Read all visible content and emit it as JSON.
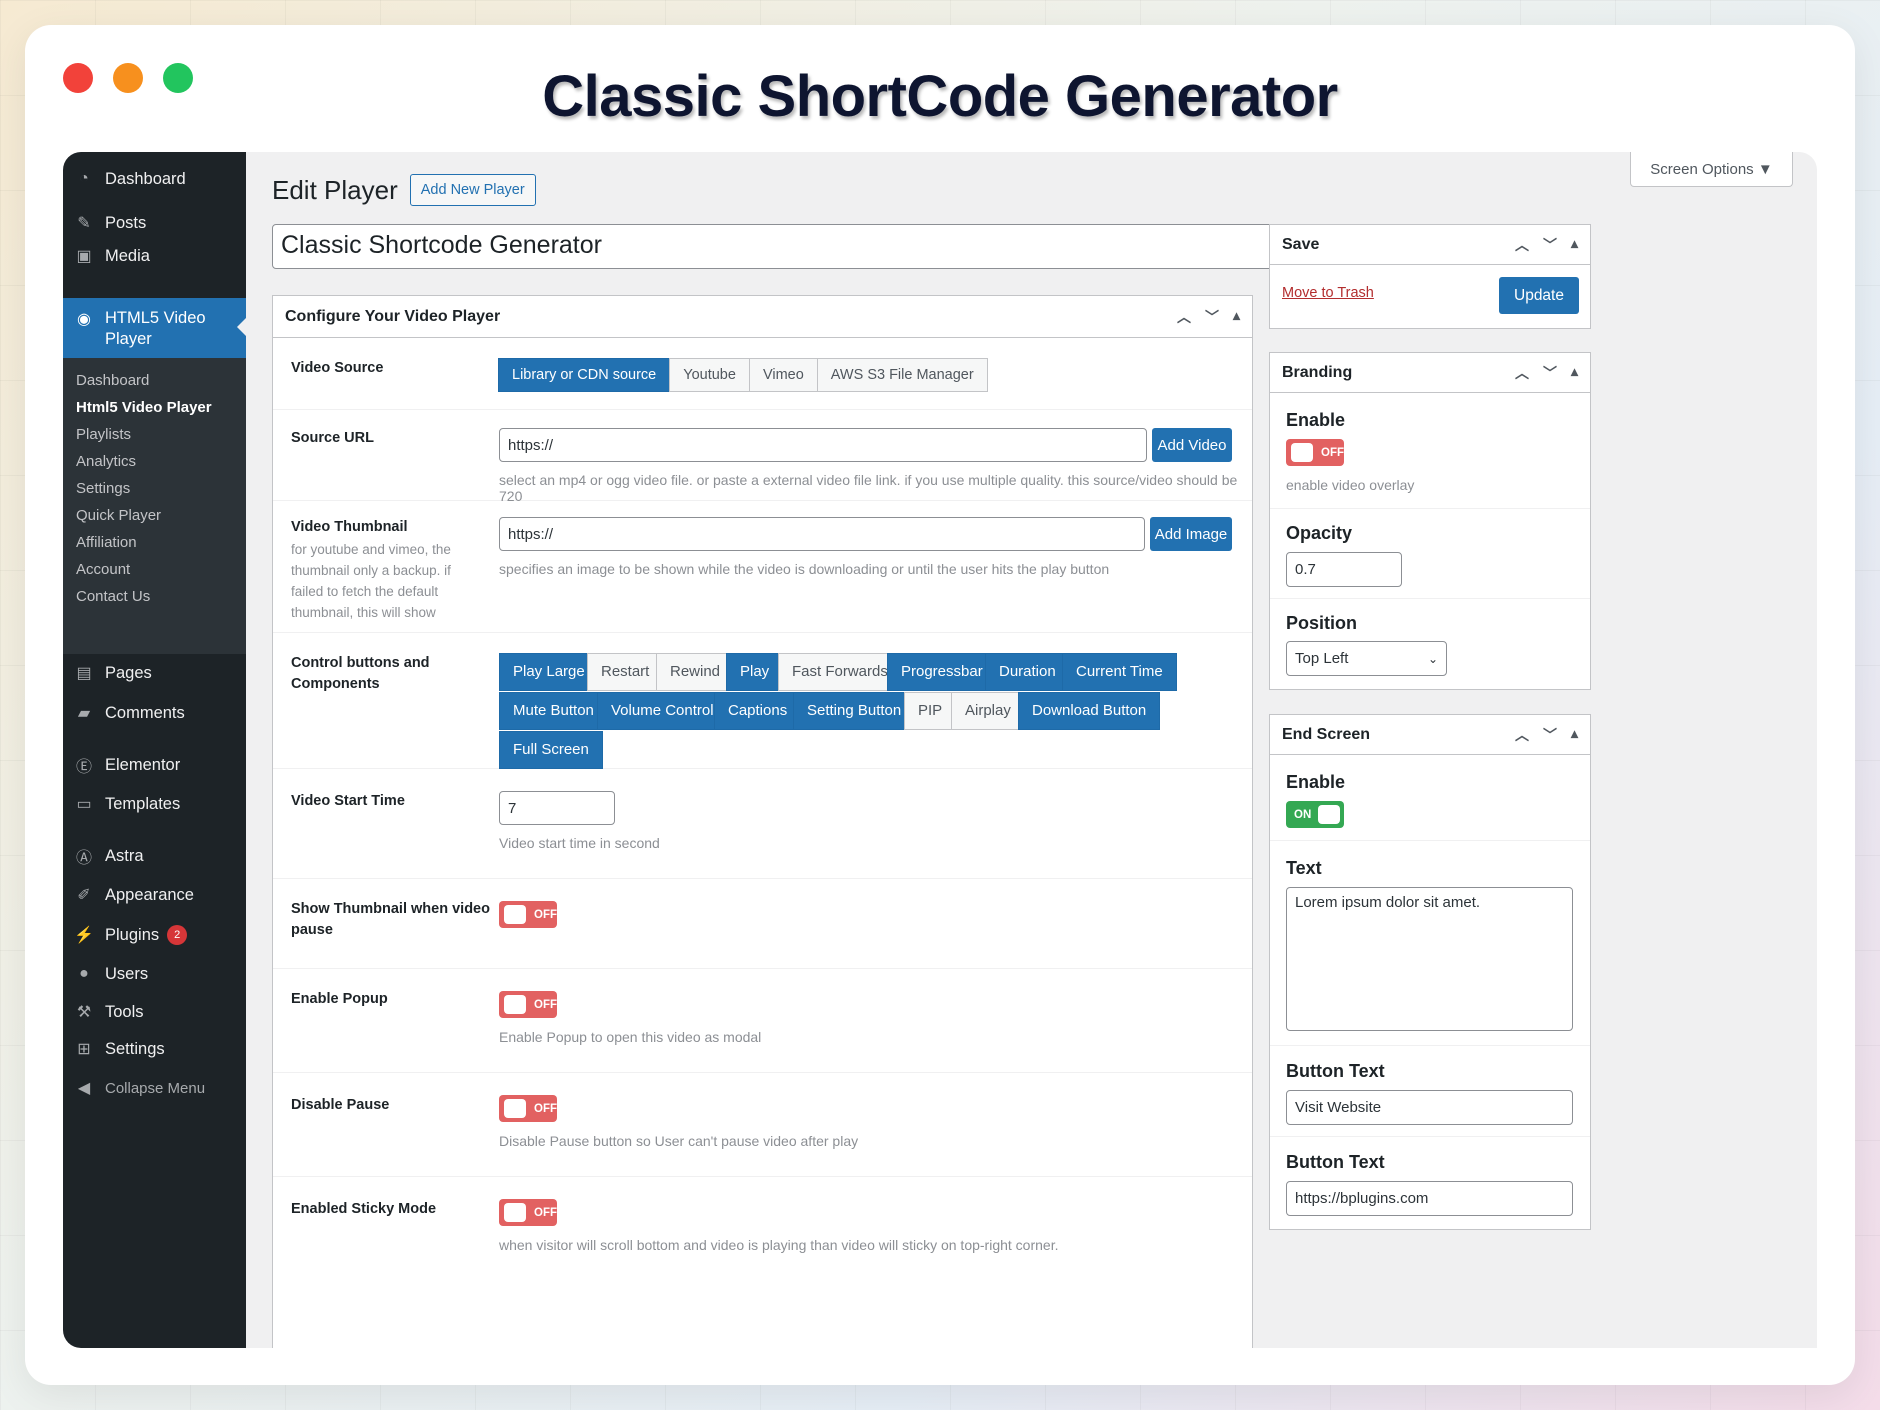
{
  "window": {
    "title": "Classic ShortCode Generator",
    "dots": [
      "#f2423a",
      "#f7901e",
      "#22c55e"
    ]
  },
  "sidebar": {
    "top_items": [
      {
        "label": "Dashboard",
        "icon": "dashboard-icon"
      },
      {
        "label": "Posts",
        "icon": "pin-icon"
      },
      {
        "label": "Media",
        "icon": "media-icon"
      }
    ],
    "active_item": {
      "label": "HTML5 Video Player",
      "icon": "play-circle-icon"
    },
    "sub_items": [
      "Dashboard",
      "Html5 Video Player",
      "Playlists",
      "Analytics",
      "Settings",
      "Quick Player",
      "Affiliation",
      "Account",
      "Contact Us"
    ],
    "current_sub": "Html5 Video Player",
    "bottom_items": [
      {
        "label": "Pages",
        "icon": "page-icon"
      },
      {
        "label": "Comments",
        "icon": "comment-icon"
      },
      {
        "label": "Elementor",
        "icon": "elementor-icon"
      },
      {
        "label": "Templates",
        "icon": "folder-icon"
      },
      {
        "label": "Astra",
        "icon": "astra-icon"
      },
      {
        "label": "Appearance",
        "icon": "brush-icon"
      },
      {
        "label": "Plugins",
        "icon": "plug-icon",
        "badge": "2"
      },
      {
        "label": "Users",
        "icon": "user-icon"
      },
      {
        "label": "Tools",
        "icon": "wrench-icon"
      },
      {
        "label": "Settings",
        "icon": "settings-icon"
      },
      {
        "label": "Collapse Menu",
        "icon": "collapse-icon"
      }
    ]
  },
  "header": {
    "screen_options": "Screen Options ▼",
    "heading": "Edit Player",
    "add_new": "Add New Player",
    "post_title": "Classic Shortcode Generator"
  },
  "config": {
    "title": "Configure Your Video Player",
    "video_source": {
      "label": "Video Source",
      "options": [
        "Library or CDN source",
        "Youtube",
        "Vimeo",
        "AWS S3 File Manager"
      ],
      "selected": "Library or CDN source"
    },
    "source_url": {
      "label": "Source URL",
      "value": "https://",
      "button": "Add Video",
      "help": "select an mp4 or ogg video file. or paste a external video file link. if you use multiple quality. this source/video should be 720"
    },
    "thumbnail": {
      "label": "Video Thumbnail",
      "desc": "for youtube and vimeo, the thumbnail only a backup. if failed to fetch the default thumbnail, this will show",
      "value": "https://",
      "button": "Add Image",
      "help": "specifies an image to be shown while the video is downloading or until the user hits the play button"
    },
    "controls": {
      "label": "Control buttons and Components",
      "chips": [
        {
          "label": "Play Large",
          "on": true
        },
        {
          "label": "Restart",
          "on": false
        },
        {
          "label": "Rewind",
          "on": false
        },
        {
          "label": "Play",
          "on": true
        },
        {
          "label": "Fast Forwards",
          "on": false
        },
        {
          "label": "Progressbar",
          "on": true
        },
        {
          "label": "Duration",
          "on": true
        },
        {
          "label": "Current Time",
          "on": true
        },
        {
          "label": "Mute Button",
          "on": true
        },
        {
          "label": "Volume Control",
          "on": true
        },
        {
          "label": "Captions",
          "on": true
        },
        {
          "label": "Setting Button",
          "on": true
        },
        {
          "label": "PIP",
          "on": false
        },
        {
          "label": "Airplay",
          "on": false
        },
        {
          "label": "Download Button",
          "on": true
        },
        {
          "label": "Full Screen",
          "on": true
        }
      ]
    },
    "start_time": {
      "label": "Video Start Time",
      "value": "7",
      "help": "Video start time in second"
    },
    "show_thumb": {
      "label": "Show Thumbnail when video pause",
      "state": "OFF"
    },
    "popup": {
      "label": "Enable Popup",
      "state": "OFF",
      "help": "Enable Popup to open this video as modal"
    },
    "disable_pause": {
      "label": "Disable Pause",
      "state": "OFF",
      "help": "Disable Pause button so User can't pause video after play"
    },
    "sticky": {
      "label": "Enabled Sticky Mode",
      "state": "OFF",
      "help": "when visitor will scroll bottom and video is playing than video will sticky on top-right corner."
    }
  },
  "save_box": {
    "title": "Save",
    "trash": "Move to Trash",
    "update": "Update"
  },
  "branding": {
    "title": "Branding",
    "enable_label": "Enable",
    "enable_state": "OFF",
    "enable_help": "enable video overlay",
    "opacity_label": "Opacity",
    "opacity_value": "0.7",
    "position_label": "Position",
    "position_value": "Top Left"
  },
  "end_screen": {
    "title": "End Screen",
    "enable_label": "Enable",
    "enable_state": "ON",
    "text_label": "Text",
    "text_value": "Lorem ipsum dolor sit amet.",
    "button_text_label": "Button Text",
    "button_text_value": "Visit Website",
    "button_link_label": "Button Text",
    "button_link_value": "https://bplugins.com"
  }
}
